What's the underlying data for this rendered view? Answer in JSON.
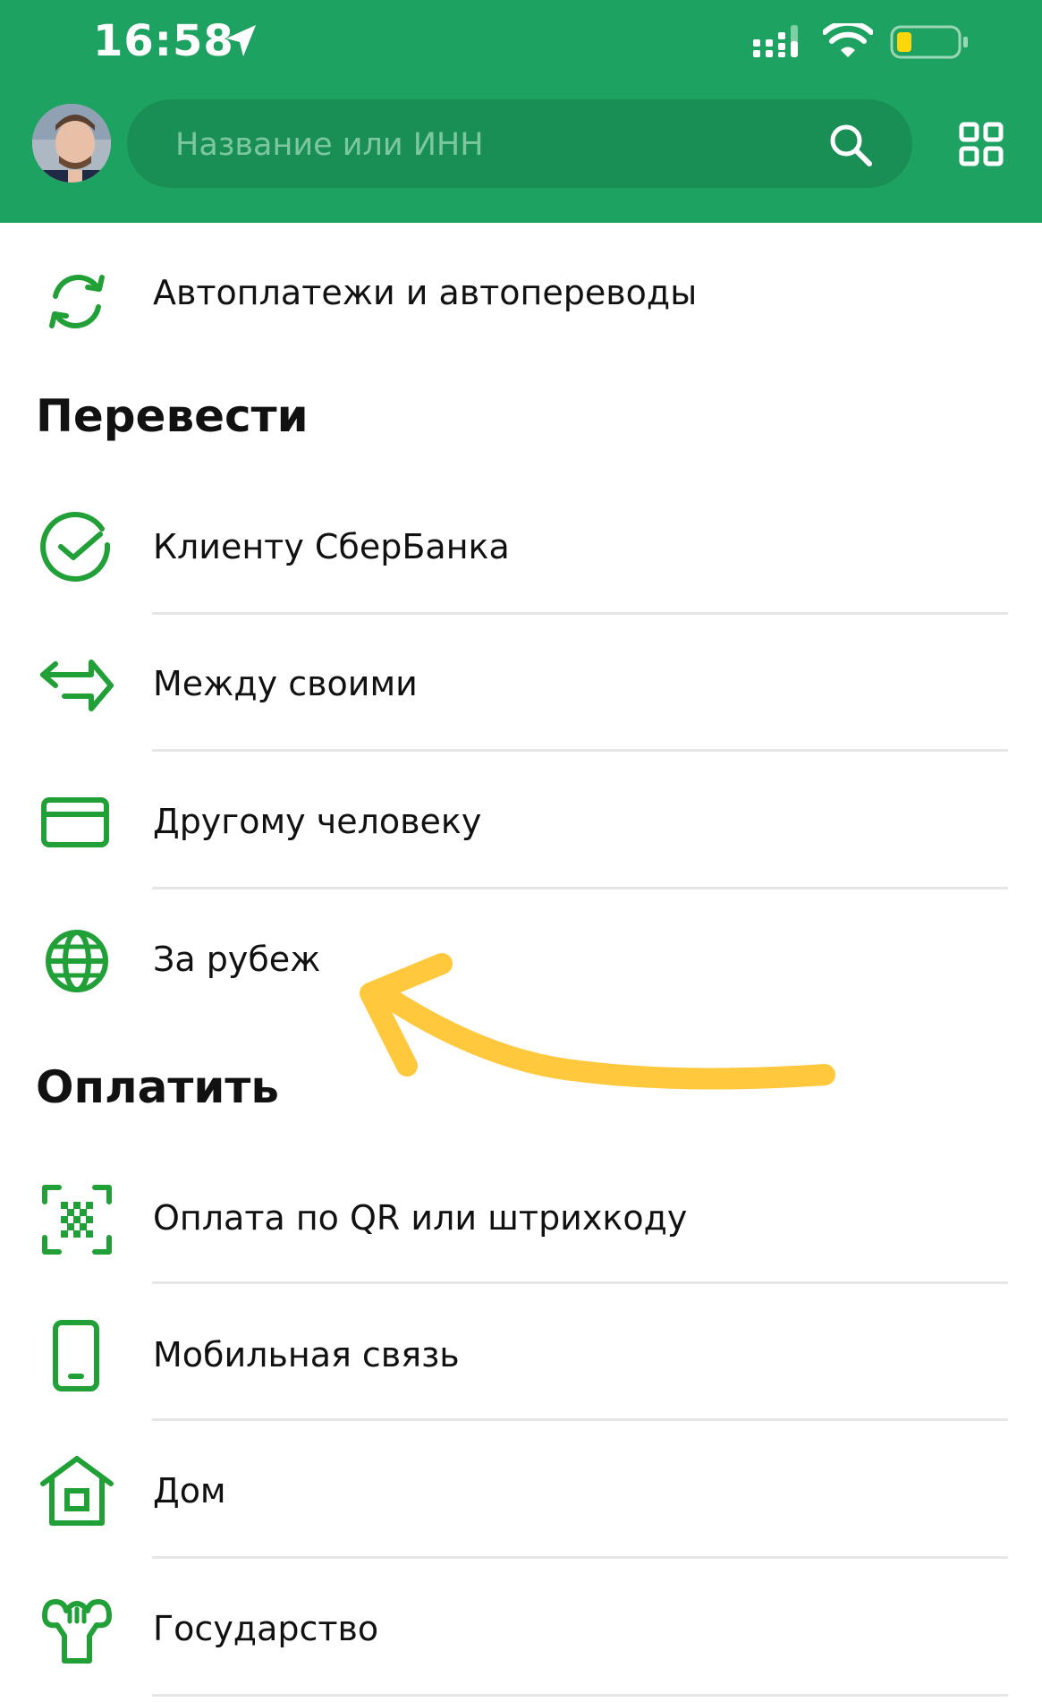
{
  "status_bar": {
    "time": "16:58",
    "icons": [
      "location-arrow-icon",
      "cellular-signal-icon",
      "wifi-icon",
      "battery-icon"
    ]
  },
  "header": {
    "search": {
      "placeholder": "Название или ИНН",
      "value": ""
    },
    "icons": [
      "avatar",
      "search-icon",
      "grid-menu-icon"
    ]
  },
  "colors": {
    "brand_green": "#1ea261",
    "search_field": "#1a8f55",
    "icon_green": "#21a038",
    "annotation_arrow": "#ffc83d",
    "battery_low": "#ffd60a"
  },
  "autopay": {
    "label": "Автоплатежи и автопереводы",
    "icon": "refresh-cycle-icon"
  },
  "transfer": {
    "title": "Перевести",
    "items": [
      {
        "label": "Клиенту СберБанка",
        "icon": "sber-check-icon"
      },
      {
        "label": "Между своими",
        "icon": "swap-arrows-icon"
      },
      {
        "label": "Другому человеку",
        "icon": "card-icon"
      },
      {
        "label": "За рубеж",
        "icon": "globe-icon"
      }
    ]
  },
  "pay": {
    "title": "Оплатить",
    "items": [
      {
        "label": "Оплата по QR или штрихкоду",
        "icon": "qr-scan-icon"
      },
      {
        "label": "Мобильная связь",
        "icon": "phone-icon"
      },
      {
        "label": "Дом",
        "icon": "home-icon"
      },
      {
        "label": "Государство",
        "icon": "state-emblem-icon"
      }
    ]
  },
  "annotation": {
    "icon": "yellow-pointer-arrow",
    "points_to": "За рубеж"
  }
}
